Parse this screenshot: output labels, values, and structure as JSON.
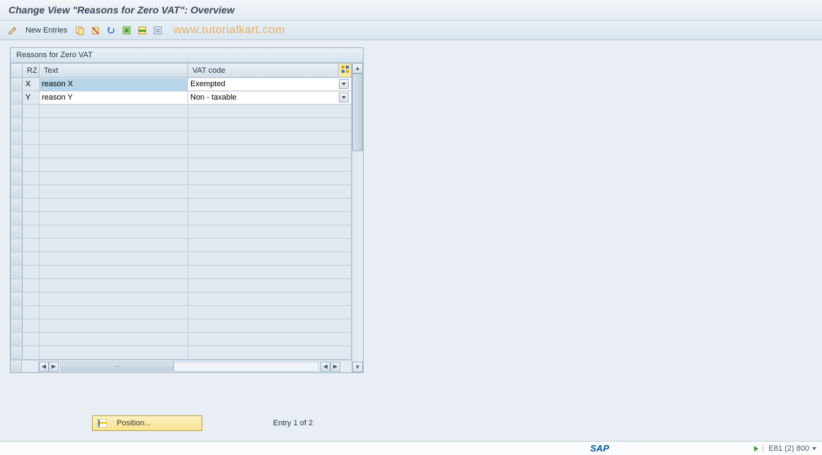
{
  "title": "Change View \"Reasons for Zero VAT\": Overview",
  "toolbar": {
    "new_entries_label": "New Entries"
  },
  "watermark": "www.tutorialkart.com",
  "panel": {
    "title": "Reasons for Zero VAT",
    "columns": {
      "rz": "RZ",
      "text": "Text",
      "vat": "VAT code"
    },
    "rows": [
      {
        "rz": "X",
        "text": "reason X",
        "vat": "Exempted",
        "selected": true
      },
      {
        "rz": "Y",
        "text": "reason Y",
        "vat": "Non - taxable",
        "selected": false
      }
    ],
    "empty_row_count": 19
  },
  "footer": {
    "position_label": "Position...",
    "entry_text": "Entry 1 of 2"
  },
  "status": {
    "sap": "SAP",
    "system": "E81 (2) 800"
  },
  "colors": {
    "accent_yellow": "#f6e290",
    "header_bg": "#e4ebf2"
  }
}
